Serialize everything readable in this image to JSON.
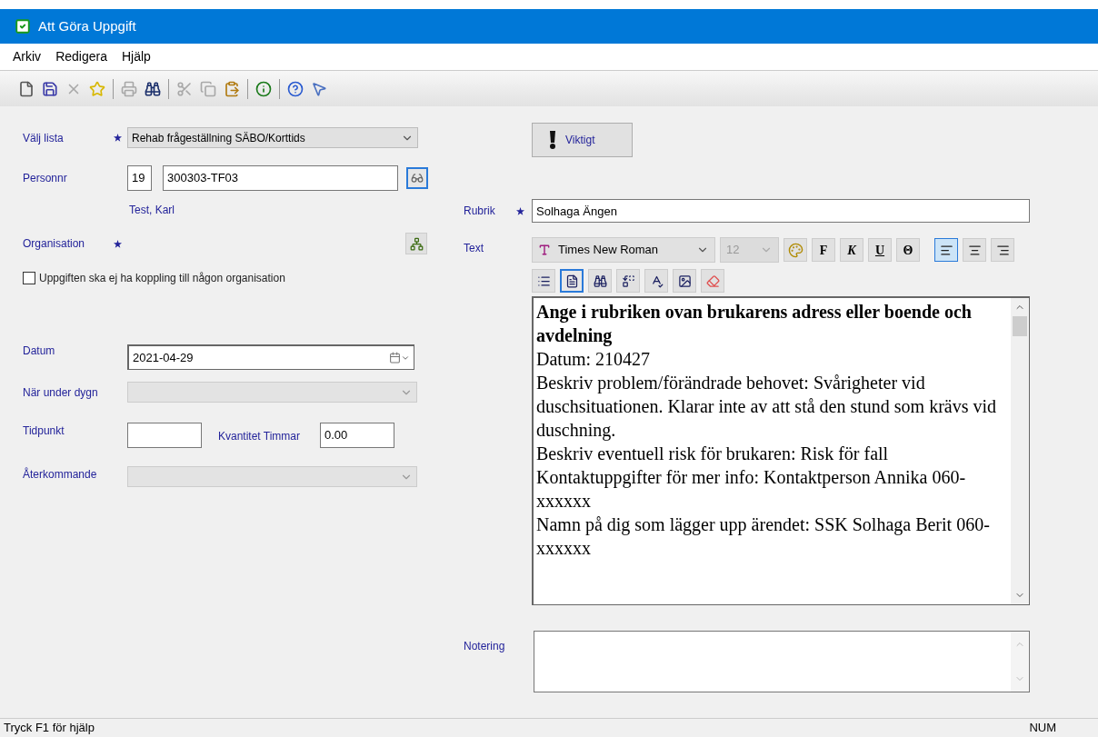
{
  "window": {
    "title": "Att Göra Uppgift"
  },
  "menu": [
    "Arkiv",
    "Redigera",
    "Hjälp"
  ],
  "toolbar": [
    {
      "kind": "new",
      "disabled": false
    },
    {
      "kind": "save",
      "disabled": false
    },
    {
      "kind": "delete",
      "disabled": true
    },
    {
      "kind": "favorite",
      "disabled": false
    },
    {
      "kind": "separator"
    },
    {
      "kind": "print",
      "disabled": true
    },
    {
      "kind": "find",
      "disabled": false
    },
    {
      "kind": "separator"
    },
    {
      "kind": "cut",
      "disabled": true
    },
    {
      "kind": "copy",
      "disabled": true
    },
    {
      "kind": "paste",
      "disabled": false
    },
    {
      "kind": "separator"
    },
    {
      "kind": "info",
      "disabled": false
    },
    {
      "kind": "separator"
    },
    {
      "kind": "help",
      "disabled": false
    },
    {
      "kind": "whats-this",
      "disabled": false
    }
  ],
  "form": {
    "list": {
      "label": "Välj lista",
      "required": true,
      "value": "Rehab frågeställning SÄBO/Korttids",
      "disabled": false
    },
    "personnr": {
      "label": "Personnr",
      "century": "19",
      "value": "300303-TF03",
      "name": "Test, Karl"
    },
    "organisation": {
      "label": "Organisation",
      "required": true
    },
    "no_org": {
      "label": "Uppgiften ska ej ha koppling till någon organisation",
      "checked": false
    },
    "datum": {
      "label": "Datum",
      "value": "2021-04-29"
    },
    "when": {
      "label": "När under dygn",
      "disabled": true
    },
    "tidpunkt": {
      "label": "Tidpunkt"
    },
    "quantity": {
      "label": "Kvantitet Timmar",
      "value": "0.00"
    },
    "recurring": {
      "label": "Återkommande",
      "disabled": true
    }
  },
  "important_button": "Viktigt",
  "rubrik": {
    "label": "Rubrik",
    "required": true,
    "value": "Solhaga Ängen"
  },
  "text": {
    "label": "Text",
    "font": "Times New Roman",
    "size": "12",
    "size_disabled": true,
    "format_buttons": [
      {
        "kind": "color"
      },
      {
        "kind": "bold",
        "label": "F"
      },
      {
        "kind": "italic",
        "label": "K"
      },
      {
        "kind": "underline",
        "label": "U"
      },
      {
        "kind": "strike",
        "label": "Θ"
      }
    ],
    "align": [
      {
        "kind": "left",
        "selected": true
      },
      {
        "kind": "center",
        "selected": false
      },
      {
        "kind": "right",
        "selected": false
      }
    ],
    "tools": [
      {
        "kind": "list",
        "selected": false,
        "disabled": false
      },
      {
        "kind": "document",
        "selected": true,
        "disabled": false
      },
      {
        "kind": "find",
        "selected": false,
        "disabled": false
      },
      {
        "kind": "replace",
        "selected": false,
        "disabled": false
      },
      {
        "kind": "spellcheck",
        "selected": false,
        "disabled": false
      },
      {
        "kind": "picture",
        "selected": false,
        "disabled": false
      },
      {
        "kind": "clear",
        "selected": false,
        "disabled": true
      }
    ],
    "paragraphs": [
      {
        "text": "Ange i rubriken ovan brukarens adress eller boende och avdelning",
        "bold": true
      },
      {
        "text": "Datum: 210427",
        "bold": false
      },
      {
        "text": "Beskriv problem/förändrade behovet: Svårigheter vid duschsituationen. Klarar inte av att stå den stund som krävs vid duschning.",
        "bold": false
      },
      {
        "text": "Beskriv eventuell risk för brukaren: Risk för fall",
        "bold": false
      },
      {
        "text": "Kontaktuppgifter för mer info: Kontaktperson Annika 060-xxxxxx",
        "bold": false
      },
      {
        "text": "Namn på dig som lägger upp ärendet: SSK Solhaga Berit 060-xxxxxx",
        "bold": false
      }
    ]
  },
  "notering": {
    "label": "Notering"
  },
  "status_bar": {
    "help": "Tryck F1 för hjälp",
    "num": "NUM"
  }
}
